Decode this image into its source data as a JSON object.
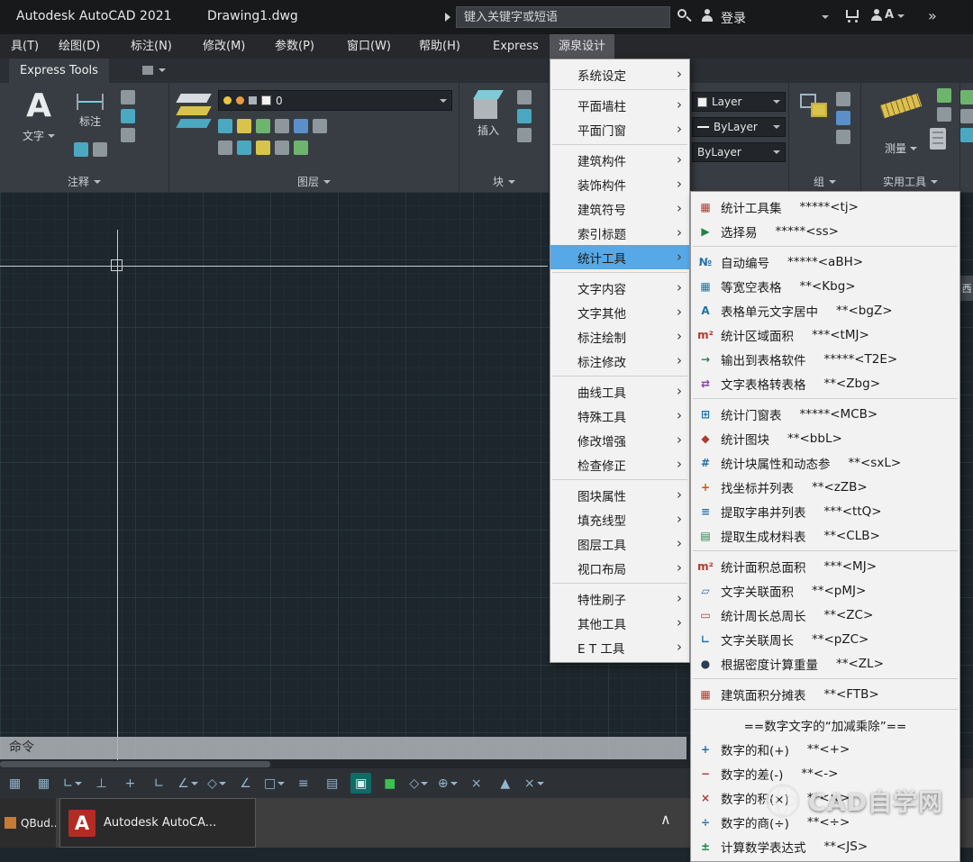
{
  "title_bar": {
    "app_name": "Autodesk AutoCAD 2021",
    "document_name": "Drawing1.dwg",
    "search_placeholder": "键入关键字或短语",
    "sign_in_label": "登录",
    "account_glyph": "A",
    "overflow_glyph": "»"
  },
  "menu_bar": {
    "active_id": "yuanquan",
    "items": [
      {
        "id": "tools",
        "label": "具(T)"
      },
      {
        "id": "draw",
        "label": "绘图(D)"
      },
      {
        "id": "dimension",
        "label": "标注(N)"
      },
      {
        "id": "modify",
        "label": "修改(M)"
      },
      {
        "id": "parametric",
        "label": "参数(P)"
      },
      {
        "id": "window",
        "label": "窗口(W)"
      },
      {
        "id": "help",
        "label": "帮助(H)"
      },
      {
        "id": "express",
        "label": "Express"
      },
      {
        "id": "yuanquan",
        "label": "源泉设计"
      }
    ]
  },
  "tab_bar": {
    "active_tab": "Express Tools"
  },
  "ribbon": {
    "annotate": {
      "text_glyph": "A",
      "text_label": "文字",
      "dim_label": "标注",
      "panel_label": "注释"
    },
    "layers": {
      "combo_value": "0",
      "panel_label": "图层"
    },
    "block": {
      "insert_label": "插入",
      "panel_label": "块"
    },
    "properties": {
      "layer_value": "Layer",
      "color_value": "ByLayer",
      "linetype_value": "ByLayer"
    },
    "group": {
      "panel_label": "组"
    },
    "utilities": {
      "measure_label": "测量",
      "panel_label": "实用工具"
    }
  },
  "context_menu": {
    "arrow_glyph": "›",
    "active_id": "stats-tools",
    "separators_after": [
      "system-settings",
      "plan-doors",
      "stats-tools",
      "dim-modify",
      "check-fix",
      "viewport-layout"
    ],
    "items": [
      {
        "id": "system-settings",
        "label": "系统设定"
      },
      {
        "id": "plan-walls",
        "label": "平面墙柱"
      },
      {
        "id": "plan-doors",
        "label": "平面门窗"
      },
      {
        "id": "building-parts",
        "label": "建筑构件"
      },
      {
        "id": "decor-parts",
        "label": "装饰构件"
      },
      {
        "id": "building-symbols",
        "label": "建筑符号"
      },
      {
        "id": "index-titles",
        "label": "索引标题"
      },
      {
        "id": "stats-tools",
        "label": "统计工具"
      },
      {
        "id": "text-content",
        "label": "文字内容"
      },
      {
        "id": "text-other",
        "label": "文字其他"
      },
      {
        "id": "dim-draw",
        "label": "标注绘制"
      },
      {
        "id": "dim-modify",
        "label": "标注修改"
      },
      {
        "id": "curve-tools",
        "label": "曲线工具"
      },
      {
        "id": "special-tools",
        "label": "特殊工具"
      },
      {
        "id": "modify-enhance",
        "label": "修改增强"
      },
      {
        "id": "check-fix",
        "label": "检查修正"
      },
      {
        "id": "block-attrs",
        "label": "图块属性"
      },
      {
        "id": "hatch-linetype",
        "label": "填充线型"
      },
      {
        "id": "layer-tools",
        "label": "图层工具"
      },
      {
        "id": "viewport-layout",
        "label": "视口布局"
      },
      {
        "id": "property-brush",
        "label": "特性刷子"
      },
      {
        "id": "other-tools",
        "label": "其他工具"
      },
      {
        "id": "et-tools",
        "label": "E T 工具"
      }
    ]
  },
  "submenu": {
    "separators_after": [
      "easy-select",
      "text-table-convert",
      "extract-material-table",
      "weight-by-density",
      "area-apportion-table"
    ],
    "items": [
      {
        "id": "stats-toolset",
        "label": "统计工具集",
        "shortcut": "*****<tj>",
        "glyph": "▦",
        "color": "#b03a2e"
      },
      {
        "id": "easy-select",
        "label": "选择易",
        "shortcut": "*****<ss>",
        "glyph": "▶",
        "color": "#1e8449"
      },
      {
        "id": "auto-number",
        "label": "自动编号",
        "shortcut": "*****<aBH>",
        "glyph": "№",
        "color": "#2471a3"
      },
      {
        "id": "equal-width-table",
        "label": "等宽空表格",
        "shortcut": "**<Kbg>",
        "glyph": "▦",
        "color": "#2471a3"
      },
      {
        "id": "table-cell-center",
        "label": "表格单元文字居中",
        "shortcut": "**<bgZ>",
        "glyph": "A",
        "color": "#2471a3"
      },
      {
        "id": "stats-region-area",
        "label": "统计区域面积",
        "shortcut": "***<tMJ>",
        "glyph": "m²",
        "color": "#b03a2e"
      },
      {
        "id": "export-to-spreadsheet",
        "label": "输出到表格软件",
        "shortcut": "*****<T2E>",
        "glyph": "→",
        "color": "#1e8449"
      },
      {
        "id": "text-table-convert",
        "label": "文字表格转表格",
        "shortcut": "**<Zbg>",
        "glyph": "⇄",
        "color": "#8e44ad"
      },
      {
        "id": "stats-door-window",
        "label": "统计门窗表",
        "shortcut": "*****<MCB>",
        "glyph": "⊞",
        "color": "#2471a3"
      },
      {
        "id": "stats-blocks",
        "label": "统计图块",
        "shortcut": "**<bbL>",
        "glyph": "◆",
        "color": "#b03a2e"
      },
      {
        "id": "stats-block-attrs",
        "label": "统计块属性和动态参",
        "shortcut": "**<sxL>",
        "glyph": "#",
        "color": "#2471a3"
      },
      {
        "id": "find-coords-list",
        "label": "找坐标并列表",
        "shortcut": "**<zZB>",
        "glyph": "+",
        "color": "#d35400"
      },
      {
        "id": "extract-strings-list",
        "label": "提取字串并列表",
        "shortcut": "***<ttQ>",
        "glyph": "≡",
        "color": "#2471a3"
      },
      {
        "id": "extract-material-table",
        "label": "提取生成材料表",
        "shortcut": "**<CLB>",
        "glyph": "▤",
        "color": "#1e8449"
      },
      {
        "id": "stats-total-area",
        "label": "统计面积总面积",
        "shortcut": "***<MJ>",
        "glyph": "m²",
        "color": "#b03a2e"
      },
      {
        "id": "text-linked-area",
        "label": "文字关联面积",
        "shortcut": "**<pMJ>",
        "glyph": "▱",
        "color": "#2471a3"
      },
      {
        "id": "stats-total-perimeter",
        "label": "统计周长总周长",
        "shortcut": "**<ZC>",
        "glyph": "▭",
        "color": "#b03a2e"
      },
      {
        "id": "text-linked-perimeter",
        "label": "文字关联周长",
        "shortcut": "**<pZC>",
        "glyph": "∟",
        "color": "#2471a3"
      },
      {
        "id": "weight-by-density",
        "label": "根据密度计算重量",
        "shortcut": "**<ZL>",
        "glyph": "●",
        "color": "#2c3e50"
      },
      {
        "id": "area-apportion-table",
        "label": "建筑面积分摊表",
        "shortcut": "**<FTB>",
        "glyph": "▦",
        "color": "#b03a2e"
      },
      {
        "id": "numeric-header",
        "type": "header",
        "label": "==数字文字的“加减乘除”=="
      },
      {
        "id": "numbers-sum",
        "label": "数字的和(+)",
        "shortcut": "**<+>",
        "glyph": "+",
        "color": "#2471a3"
      },
      {
        "id": "numbers-difference",
        "label": "数字的差(-)",
        "shortcut": "**<->",
        "glyph": "−",
        "color": "#b03a2e"
      },
      {
        "id": "numbers-product",
        "label": "数字的积(×)",
        "shortcut": "**<×>",
        "glyph": "×",
        "color": "#b03a2e"
      },
      {
        "id": "numbers-quotient",
        "label": "数字的商(÷)",
        "shortcut": "**<÷>",
        "glyph": "÷",
        "color": "#2471a3"
      },
      {
        "id": "calc-expression",
        "label": "计算数学表达式",
        "shortcut": "**<JS>",
        "glyph": "±",
        "color": "#1e8449"
      }
    ]
  },
  "command_bar": {
    "prompt": "命令"
  },
  "status_bar": {
    "icons": [
      {
        "id": "model-grid",
        "glyph": "▦"
      },
      {
        "id": "grid-display",
        "glyph": "▦"
      },
      {
        "id": "snap-mode",
        "glyph": "∟",
        "caret": true
      },
      {
        "id": "infer-constraints",
        "glyph": "⊥"
      },
      {
        "id": "dynamic-input",
        "glyph": "+"
      },
      {
        "id": "ortho-mode",
        "glyph": "∟"
      },
      {
        "id": "polar-tracking",
        "glyph": "∠",
        "caret": true
      },
      {
        "id": "isometric-drafting",
        "glyph": "◇",
        "caret": true
      },
      {
        "id": "object-snap-tracking",
        "glyph": "∠"
      },
      {
        "id": "object-snap",
        "glyph": "□",
        "caret": true
      },
      {
        "id": "lineweight",
        "glyph": "≡"
      },
      {
        "id": "transparency",
        "glyph": "▤"
      },
      {
        "id": "selection-cycling",
        "glyph": "▣",
        "state": "teal"
      },
      {
        "id": "dynamic-ucs",
        "glyph": "■",
        "state": "green"
      },
      {
        "id": "selection-filter",
        "glyph": "◇",
        "caret": true
      },
      {
        "id": "gizmo",
        "glyph": "⊕",
        "caret": true
      },
      {
        "id": "annotation-visibility",
        "glyph": "×"
      },
      {
        "id": "autoscale",
        "glyph": "▲"
      },
      {
        "id": "annotation-scale",
        "glyph": "×",
        "caret": true
      }
    ]
  },
  "taskbar": {
    "app1_label": "QBud...",
    "app2_label": "Autodesk AutoCA...",
    "app2_logo_glyph": "A",
    "tray_expand_glyph": "∧"
  },
  "watermark": {
    "text": "CAD自学网"
  },
  "palette_tab": {
    "label": "西"
  }
}
